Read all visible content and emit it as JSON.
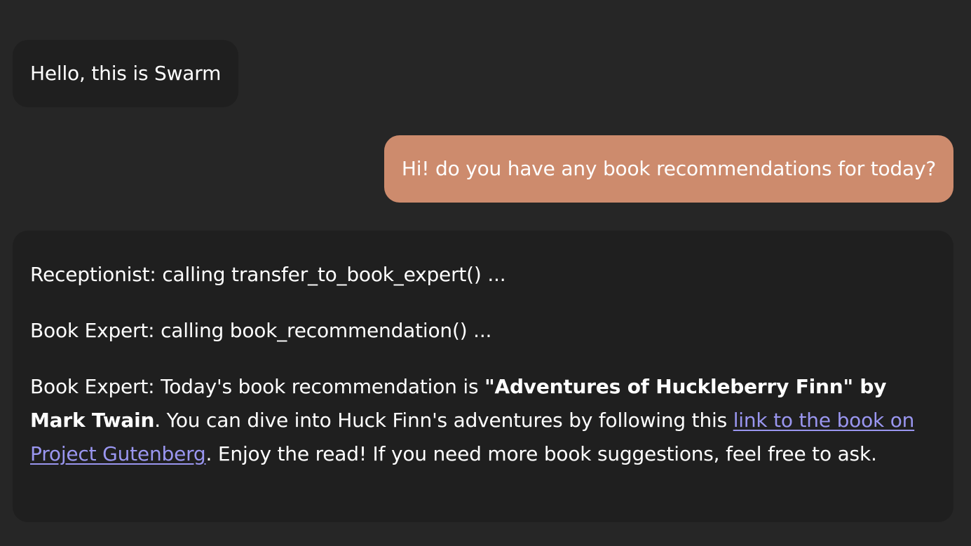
{
  "messages": {
    "greeting": "Hello, this is Swarm",
    "user_question": "Hi! do you have any book recommendations for today?",
    "reply": {
      "line1": "Receptionist: calling transfer_to_book_expert() ...",
      "line2": "Book Expert: calling book_recommendation() ...",
      "line3_pre": "Book Expert: Today's book recommendation is ",
      "line3_bold": "\"Adventures of Huckleberry Finn\" by Mark Twain",
      "line3_mid": ". You can dive into Huck Finn's adventures by following this ",
      "line3_link": "link to the book on Project Gutenberg",
      "line3_post": ". Enjoy the read! If you need more book suggestions, feel free to ask."
    }
  },
  "colors": {
    "background": "#262626",
    "bot_bubble": "#1f1f1f",
    "user_bubble": "#cd8b6d",
    "link": "#9a96f0"
  }
}
